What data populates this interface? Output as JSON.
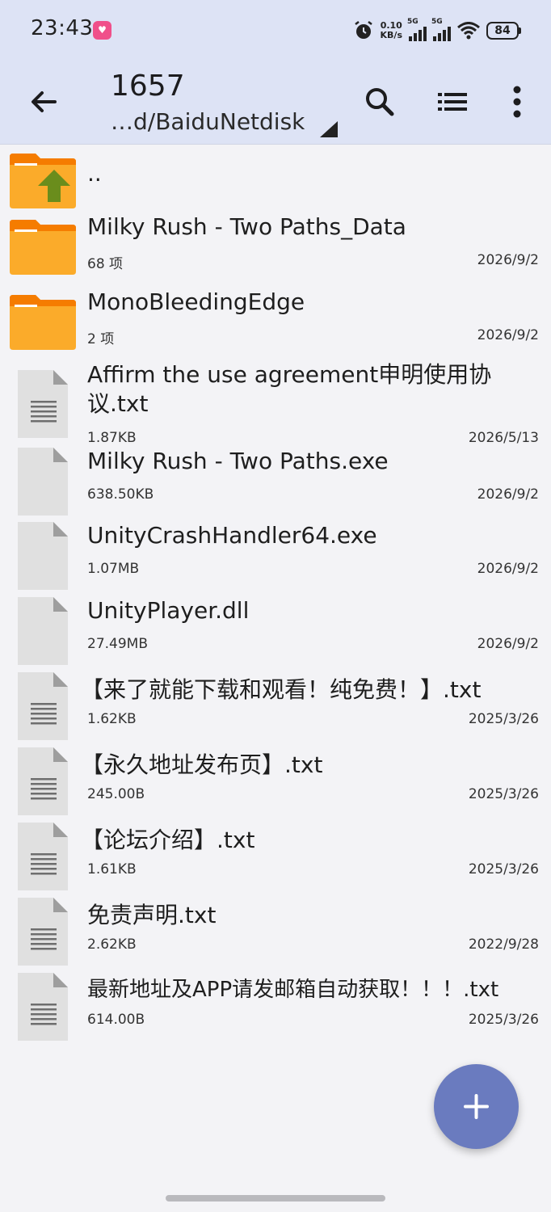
{
  "status_bar": {
    "time": "23:43",
    "net_speed_value": "0.10",
    "net_speed_unit": "KB/s",
    "sim1_label": "5G",
    "sim2_label": "5G",
    "battery": "84"
  },
  "toolbar": {
    "title": "1657",
    "path": "…d/BaiduNetdisk",
    "icons": [
      "back-arrow-icon",
      "search-icon",
      "list-view-icon",
      "more-vert-icon"
    ]
  },
  "files": {
    "parent": {
      "name": ".."
    },
    "items": [
      {
        "name": "Milky Rush - Two Paths_Data",
        "meta": "68 项",
        "date": "2026/9/2",
        "kind": "folder"
      },
      {
        "name": "MonoBleedingEdge",
        "meta": "2 项",
        "date": "2026/9/2",
        "kind": "folder"
      },
      {
        "name": "Affirm the use agreement申明使用协议.txt",
        "meta": "1.87KB",
        "date": "2026/5/13",
        "kind": "text"
      },
      {
        "name": "Milky Rush - Two Paths.exe",
        "meta": "638.50KB",
        "date": "2026/9/2",
        "kind": "blank"
      },
      {
        "name": "UnityCrashHandler64.exe",
        "meta": "1.07MB",
        "date": "2026/9/2",
        "kind": "blank"
      },
      {
        "name": "UnityPlayer.dll",
        "meta": "27.49MB",
        "date": "2026/9/2",
        "kind": "blank"
      },
      {
        "name": "【来了就能下载和观看！纯免费！】.txt",
        "meta": "1.62KB",
        "date": "2025/3/26",
        "kind": "text"
      },
      {
        "name": "【永久地址发布页】.txt",
        "meta": "245.00B",
        "date": "2025/3/26",
        "kind": "text"
      },
      {
        "name": "【论坛介绍】.txt",
        "meta": "1.61KB",
        "date": "2025/3/26",
        "kind": "text"
      },
      {
        "name": "免责声明.txt",
        "meta": "2.62KB",
        "date": "2022/9/28",
        "kind": "text"
      },
      {
        "name": "最新地址及APP请发邮箱自动获取！！！.txt",
        "meta": "614.00B",
        "date": "2025/3/26",
        "kind": "text"
      }
    ]
  },
  "colors": {
    "header_bg": "#dde3f5",
    "folder": "#fbab2a",
    "folder_tab": "#f57c00",
    "up_arrow": "#6a8d1c",
    "fab": "#6a7bbf"
  }
}
